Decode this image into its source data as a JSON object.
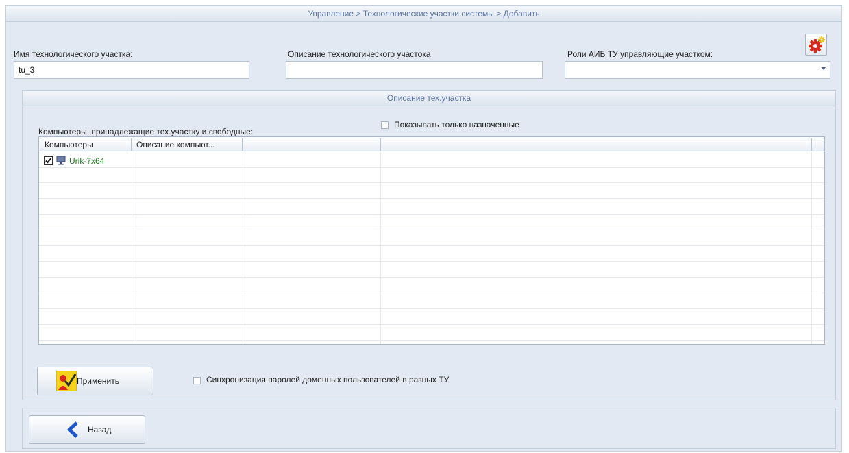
{
  "breadcrumb": "Управление > Технологические участки системы > Добавить",
  "form": {
    "name_label": "Имя технологического участка:",
    "name_value": "tu_3",
    "desc_label": "Описание технологического участока",
    "desc_value": "",
    "roles_label": "Роли АИБ ТУ управляющие участком:",
    "roles_value": ""
  },
  "gear_icon": "gear-icon",
  "panel": {
    "title": "Описание тех.участка",
    "computers_label": "Компьютеры, принадлежащие тех.участку и свободные:",
    "show_assigned_label": "Показывать только назначенные",
    "show_assigned_checked": false,
    "table": {
      "columns": [
        "Компьютеры",
        "Описание компьют...",
        "",
        ""
      ],
      "rows": [
        {
          "checked": true,
          "name": "Urik-7x64",
          "description": ""
        }
      ]
    },
    "apply_label": "Применить",
    "sync_label": "Синхронизация паролей доменных пользователей в разных ТУ",
    "sync_checked": false
  },
  "back_label": "Назад",
  "colors": {
    "accent_text": "#5a73a3",
    "computer_name": "#1e7b1e",
    "background": "#e3e9f2"
  }
}
